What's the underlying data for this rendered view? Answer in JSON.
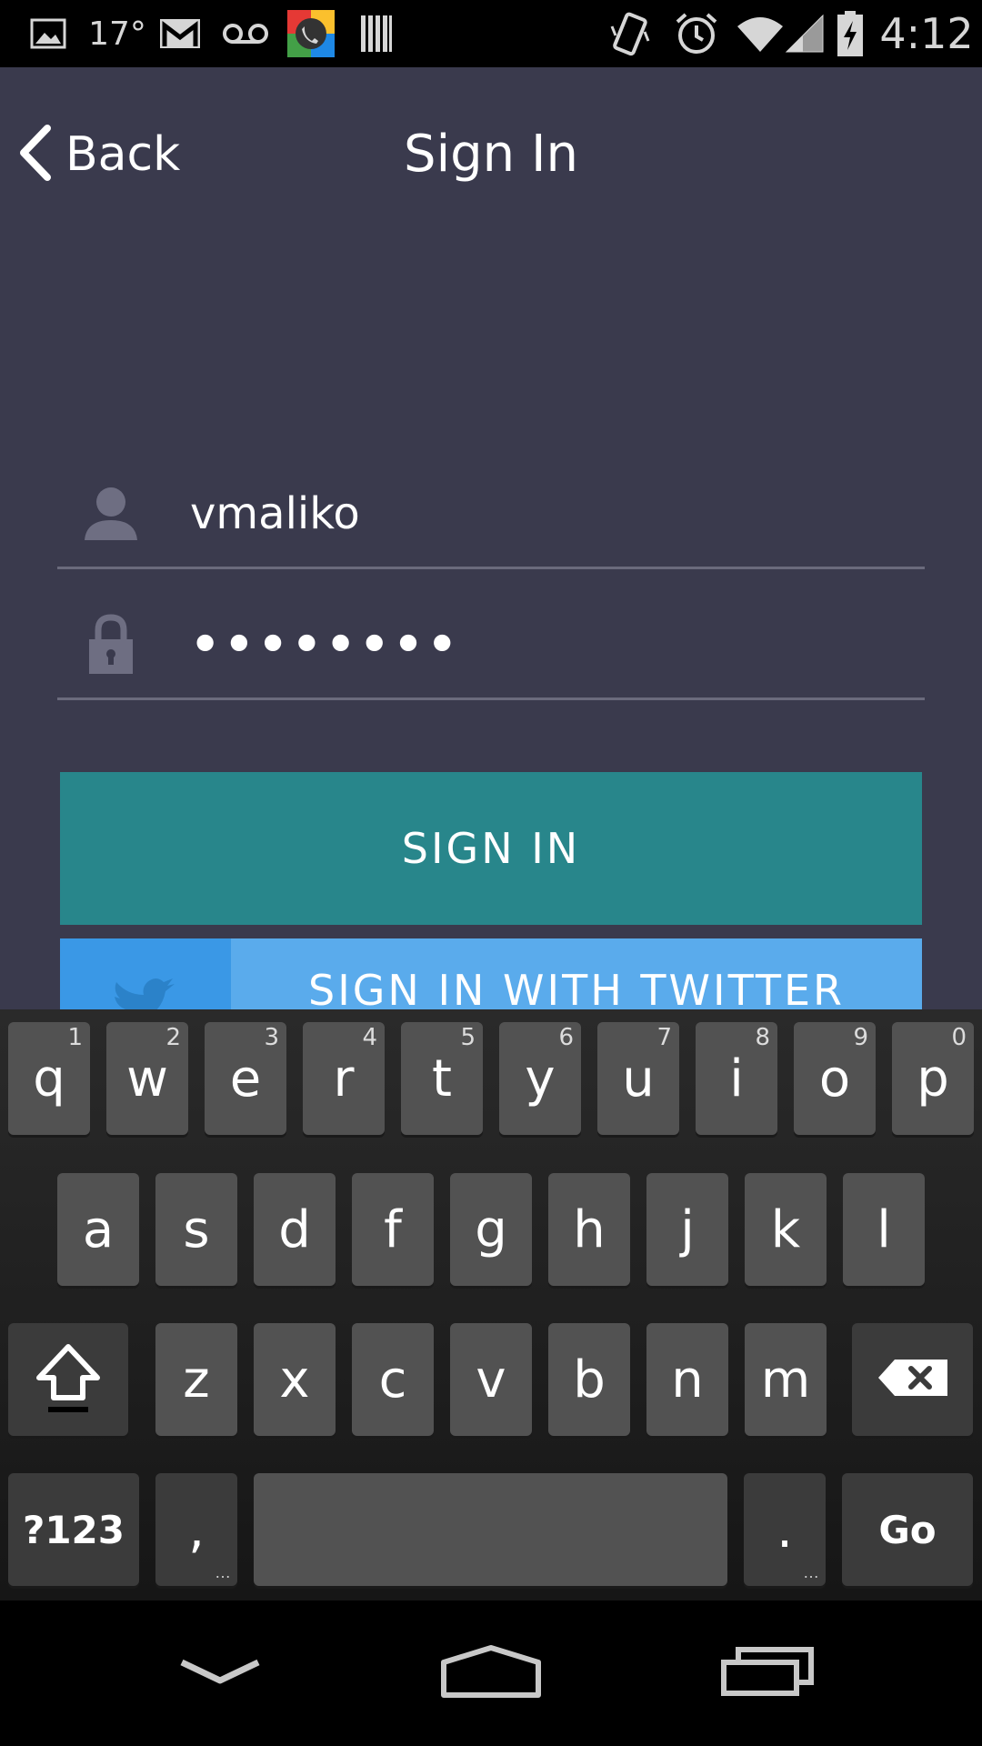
{
  "status_bar": {
    "temperature": "17°",
    "time": "4:12",
    "icons": [
      "image-icon",
      "gmail-icon",
      "voicemail-icon",
      "hangouts-icon",
      "barcode-icon",
      "vibrate-icon",
      "alarm-icon",
      "wifi-icon",
      "cell-signal-icon",
      "battery-charging-icon"
    ]
  },
  "header": {
    "back_label": "Back",
    "title": "Sign In"
  },
  "form": {
    "username": {
      "value": "vmaliko",
      "icon": "user-icon"
    },
    "password": {
      "value": "••••••••",
      "icon": "lock-icon"
    },
    "sign_in_label": "SIGN IN",
    "twitter_label": "SIGN IN WITH TWITTER"
  },
  "colors": {
    "background": "#3a3a4d",
    "sign_in": "#28868b",
    "twitter": "#5aabec",
    "twitter_icon_bg": "#3a98e6"
  },
  "keyboard": {
    "row1": [
      {
        "k": "q",
        "h": "1"
      },
      {
        "k": "w",
        "h": "2"
      },
      {
        "k": "e",
        "h": "3"
      },
      {
        "k": "r",
        "h": "4"
      },
      {
        "k": "t",
        "h": "5"
      },
      {
        "k": "y",
        "h": "6"
      },
      {
        "k": "u",
        "h": "7"
      },
      {
        "k": "i",
        "h": "8"
      },
      {
        "k": "o",
        "h": "9"
      },
      {
        "k": "p",
        "h": "0"
      }
    ],
    "row2": [
      "a",
      "s",
      "d",
      "f",
      "g",
      "h",
      "j",
      "k",
      "l"
    ],
    "row3": [
      "z",
      "x",
      "c",
      "v",
      "b",
      "n",
      "m"
    ],
    "symbols_label": "?123",
    "comma_label": ",",
    "period_label": ".",
    "go_label": "Go"
  }
}
